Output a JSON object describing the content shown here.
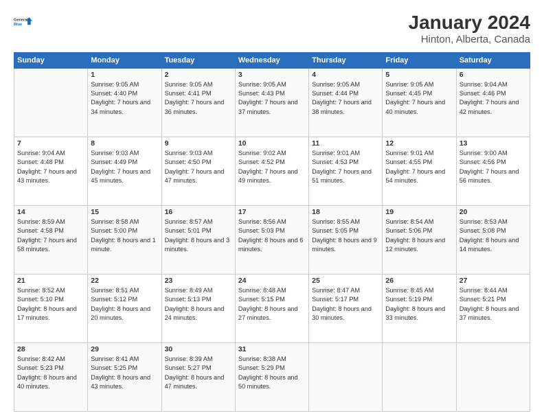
{
  "header": {
    "logo_line1": "General",
    "logo_line2": "Blue",
    "title": "January 2024",
    "subtitle": "Hinton, Alberta, Canada"
  },
  "days_of_week": [
    "Sunday",
    "Monday",
    "Tuesday",
    "Wednesday",
    "Thursday",
    "Friday",
    "Saturday"
  ],
  "weeks": [
    [
      {
        "day": "",
        "content": ""
      },
      {
        "day": "1",
        "content": "Sunrise: 9:05 AM\nSunset: 4:40 PM\nDaylight: 7 hours\nand 34 minutes."
      },
      {
        "day": "2",
        "content": "Sunrise: 9:05 AM\nSunset: 4:41 PM\nDaylight: 7 hours\nand 36 minutes."
      },
      {
        "day": "3",
        "content": "Sunrise: 9:05 AM\nSunset: 4:43 PM\nDaylight: 7 hours\nand 37 minutes."
      },
      {
        "day": "4",
        "content": "Sunrise: 9:05 AM\nSunset: 4:44 PM\nDaylight: 7 hours\nand 38 minutes."
      },
      {
        "day": "5",
        "content": "Sunrise: 9:05 AM\nSunset: 4:45 PM\nDaylight: 7 hours\nand 40 minutes."
      },
      {
        "day": "6",
        "content": "Sunrise: 9:04 AM\nSunset: 4:46 PM\nDaylight: 7 hours\nand 42 minutes."
      }
    ],
    [
      {
        "day": "7",
        "content": "Sunrise: 9:04 AM\nSunset: 4:48 PM\nDaylight: 7 hours\nand 43 minutes."
      },
      {
        "day": "8",
        "content": "Sunrise: 9:03 AM\nSunset: 4:49 PM\nDaylight: 7 hours\nand 45 minutes."
      },
      {
        "day": "9",
        "content": "Sunrise: 9:03 AM\nSunset: 4:50 PM\nDaylight: 7 hours\nand 47 minutes."
      },
      {
        "day": "10",
        "content": "Sunrise: 9:02 AM\nSunset: 4:52 PM\nDaylight: 7 hours\nand 49 minutes."
      },
      {
        "day": "11",
        "content": "Sunrise: 9:01 AM\nSunset: 4:53 PM\nDaylight: 7 hours\nand 51 minutes."
      },
      {
        "day": "12",
        "content": "Sunrise: 9:01 AM\nSunset: 4:55 PM\nDaylight: 7 hours\nand 54 minutes."
      },
      {
        "day": "13",
        "content": "Sunrise: 9:00 AM\nSunset: 4:56 PM\nDaylight: 7 hours\nand 56 minutes."
      }
    ],
    [
      {
        "day": "14",
        "content": "Sunrise: 8:59 AM\nSunset: 4:58 PM\nDaylight: 7 hours\nand 58 minutes."
      },
      {
        "day": "15",
        "content": "Sunrise: 8:58 AM\nSunset: 5:00 PM\nDaylight: 8 hours\nand 1 minute."
      },
      {
        "day": "16",
        "content": "Sunrise: 8:57 AM\nSunset: 5:01 PM\nDaylight: 8 hours\nand 3 minutes."
      },
      {
        "day": "17",
        "content": "Sunrise: 8:56 AM\nSunset: 5:03 PM\nDaylight: 8 hours\nand 6 minutes."
      },
      {
        "day": "18",
        "content": "Sunrise: 8:55 AM\nSunset: 5:05 PM\nDaylight: 8 hours\nand 9 minutes."
      },
      {
        "day": "19",
        "content": "Sunrise: 8:54 AM\nSunset: 5:06 PM\nDaylight: 8 hours\nand 12 minutes."
      },
      {
        "day": "20",
        "content": "Sunrise: 8:53 AM\nSunset: 5:08 PM\nDaylight: 8 hours\nand 14 minutes."
      }
    ],
    [
      {
        "day": "21",
        "content": "Sunrise: 8:52 AM\nSunset: 5:10 PM\nDaylight: 8 hours\nand 17 minutes."
      },
      {
        "day": "22",
        "content": "Sunrise: 8:51 AM\nSunset: 5:12 PM\nDaylight: 8 hours\nand 20 minutes."
      },
      {
        "day": "23",
        "content": "Sunrise: 8:49 AM\nSunset: 5:13 PM\nDaylight: 8 hours\nand 24 minutes."
      },
      {
        "day": "24",
        "content": "Sunrise: 8:48 AM\nSunset: 5:15 PM\nDaylight: 8 hours\nand 27 minutes."
      },
      {
        "day": "25",
        "content": "Sunrise: 8:47 AM\nSunset: 5:17 PM\nDaylight: 8 hours\nand 30 minutes."
      },
      {
        "day": "26",
        "content": "Sunrise: 8:45 AM\nSunset: 5:19 PM\nDaylight: 8 hours\nand 33 minutes."
      },
      {
        "day": "27",
        "content": "Sunrise: 8:44 AM\nSunset: 5:21 PM\nDaylight: 8 hours\nand 37 minutes."
      }
    ],
    [
      {
        "day": "28",
        "content": "Sunrise: 8:42 AM\nSunset: 5:23 PM\nDaylight: 8 hours\nand 40 minutes."
      },
      {
        "day": "29",
        "content": "Sunrise: 8:41 AM\nSunset: 5:25 PM\nDaylight: 8 hours\nand 43 minutes."
      },
      {
        "day": "30",
        "content": "Sunrise: 8:39 AM\nSunset: 5:27 PM\nDaylight: 8 hours\nand 47 minutes."
      },
      {
        "day": "31",
        "content": "Sunrise: 8:38 AM\nSunset: 5:29 PM\nDaylight: 8 hours\nand 50 minutes."
      },
      {
        "day": "",
        "content": ""
      },
      {
        "day": "",
        "content": ""
      },
      {
        "day": "",
        "content": ""
      }
    ]
  ]
}
